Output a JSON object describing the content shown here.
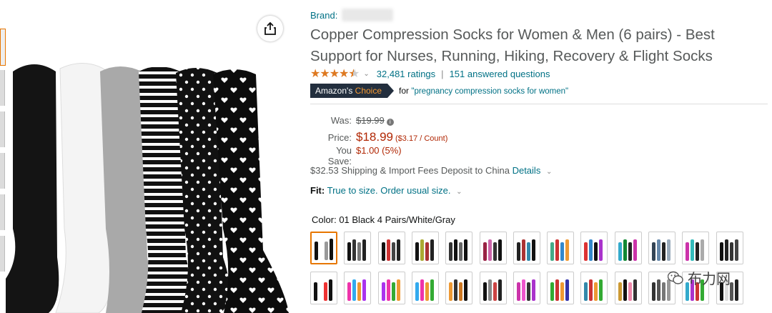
{
  "brand": {
    "label": "Brand:"
  },
  "product": {
    "title": "Copper Compression Socks for Women & Men (6 pairs) - Best Support for Nurses, Running, Hiking, Recovery & Flight Socks"
  },
  "rating": {
    "stars_value": 4.5,
    "ratings_count": "32,481 ratings",
    "separator": "|",
    "answered_questions": "151 answered questions"
  },
  "choice": {
    "badge_prefix": "Amazon's",
    "badge_suffix": "Choice",
    "for_label": "for",
    "query": "\"pregnancy compression socks for women\""
  },
  "pricing": {
    "was_label": "Was:",
    "was_value": "$19.99",
    "price_label": "Price:",
    "price_value": "$18.99",
    "per_count": "($3.17 / Count)",
    "save_label": "You Save:",
    "save_value": "$1.00 (5%)"
  },
  "shipping": {
    "text": "$32.53 Shipping & Import Fees Deposit to China",
    "details_link": "Details"
  },
  "fit": {
    "label": "Fit:",
    "value": "True to size. Order usual size."
  },
  "color": {
    "label": "Color:",
    "selected": "01 Black 4 Pairs/White/Gray"
  },
  "watermark": {
    "text": "布力网"
  },
  "icons": {
    "share": "share-icon",
    "info": "info-icon",
    "chevron": "chevron-down-icon",
    "wechat": "wechat-icon"
  },
  "colors": {
    "link": "#007185",
    "price": "#b12704",
    "star": "#de7921",
    "badge_bg": "#232f3e",
    "badge_accent": "#f69931",
    "selected_border": "#e77600"
  }
}
